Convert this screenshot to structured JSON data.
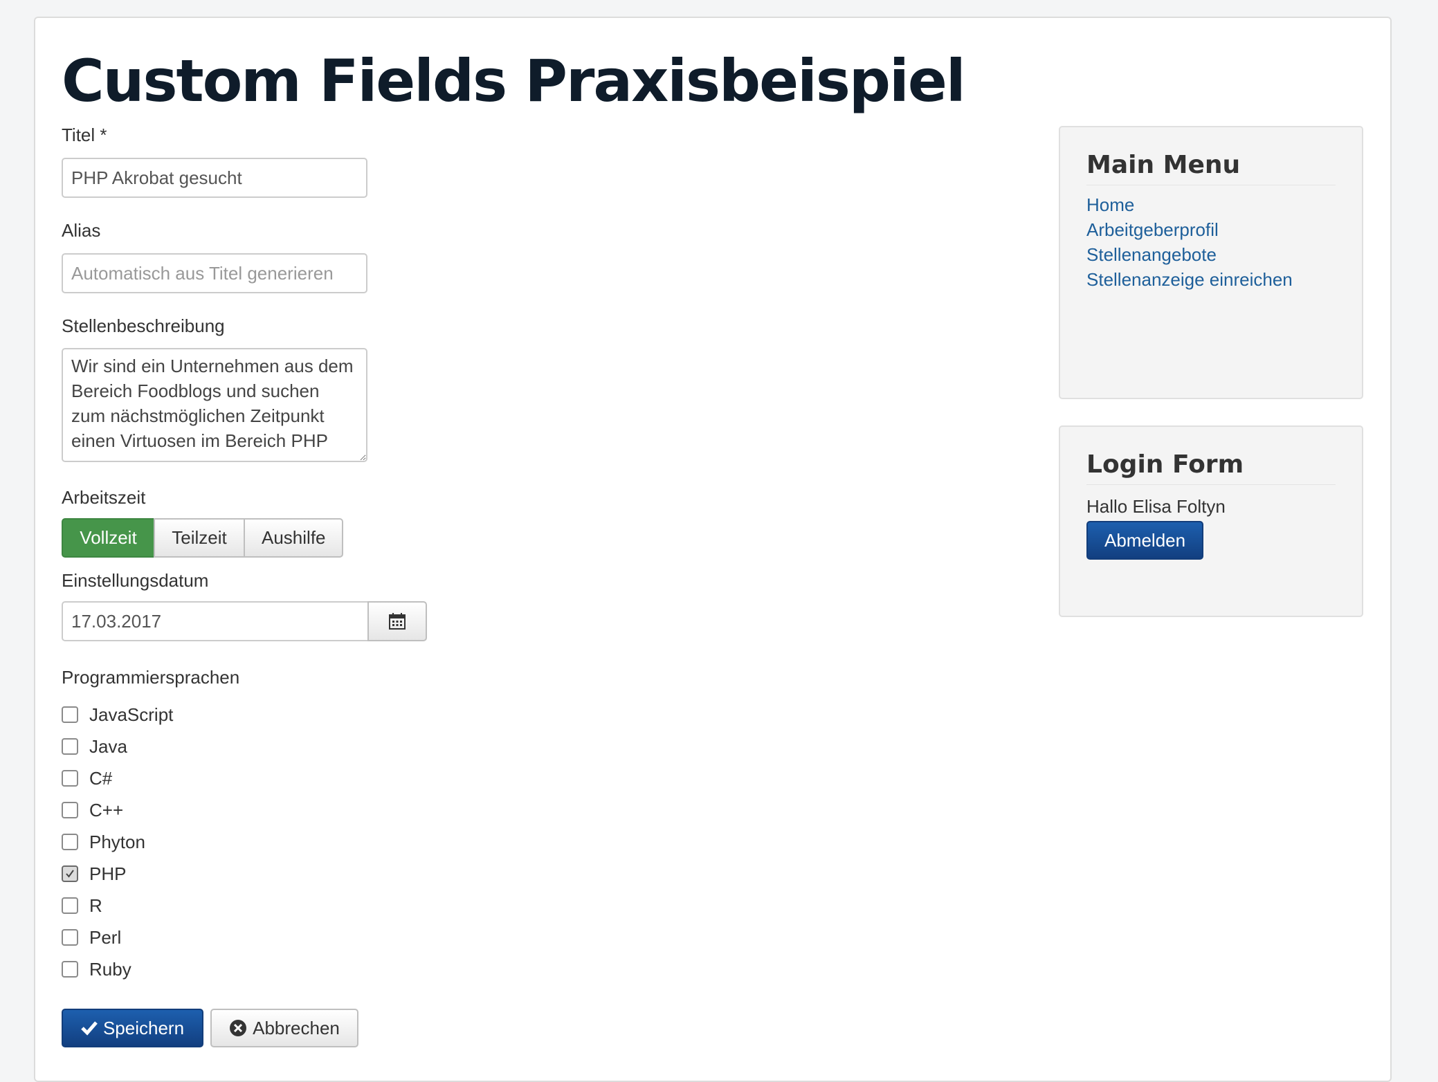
{
  "page": {
    "title": "Custom Fields Praxisbeispiel"
  },
  "form": {
    "title_label": "Titel *",
    "title_value": "PHP Akrobat gesucht",
    "alias_label": "Alias",
    "alias_placeholder": "Automatisch aus Titel generieren",
    "description_label": "Stellenbeschreibung",
    "description_value": "Wir sind ein Unternehmen aus dem Bereich Foodblogs und suchen zum nächstmöglichen Zeitpunkt einen Virtuosen im Bereich PHP",
    "worktime_label": "Arbeitszeit",
    "worktime_options": [
      "Vollzeit",
      "Teilzeit",
      "Aushilfe"
    ],
    "worktime_selected": "Vollzeit",
    "date_label": "Einstellungsdatum",
    "date_value": "17.03.2017",
    "languages_label": "Programmiersprachen",
    "languages": [
      {
        "label": "JavaScript",
        "checked": false
      },
      {
        "label": "Java",
        "checked": false
      },
      {
        "label": "C#",
        "checked": false
      },
      {
        "label": "C++",
        "checked": false
      },
      {
        "label": "Phyton",
        "checked": false
      },
      {
        "label": "PHP",
        "checked": true
      },
      {
        "label": "R",
        "checked": false
      },
      {
        "label": "Perl",
        "checked": false
      },
      {
        "label": "Ruby",
        "checked": false
      }
    ],
    "save_label": "Speichern",
    "cancel_label": "Abbrechen"
  },
  "main_menu": {
    "title": "Main Menu",
    "items": [
      "Home",
      "Arbeitgeberprofil",
      "Stellenangebote",
      "Stellenanzeige einreichen"
    ]
  },
  "login_form": {
    "title": "Login Form",
    "greeting": "Hallo Elisa Foltyn",
    "logout_label": "Abmelden"
  },
  "colors": {
    "active_segment": "#46954a",
    "primary_button": "#1a4f94",
    "link": "#1e5f9a"
  }
}
